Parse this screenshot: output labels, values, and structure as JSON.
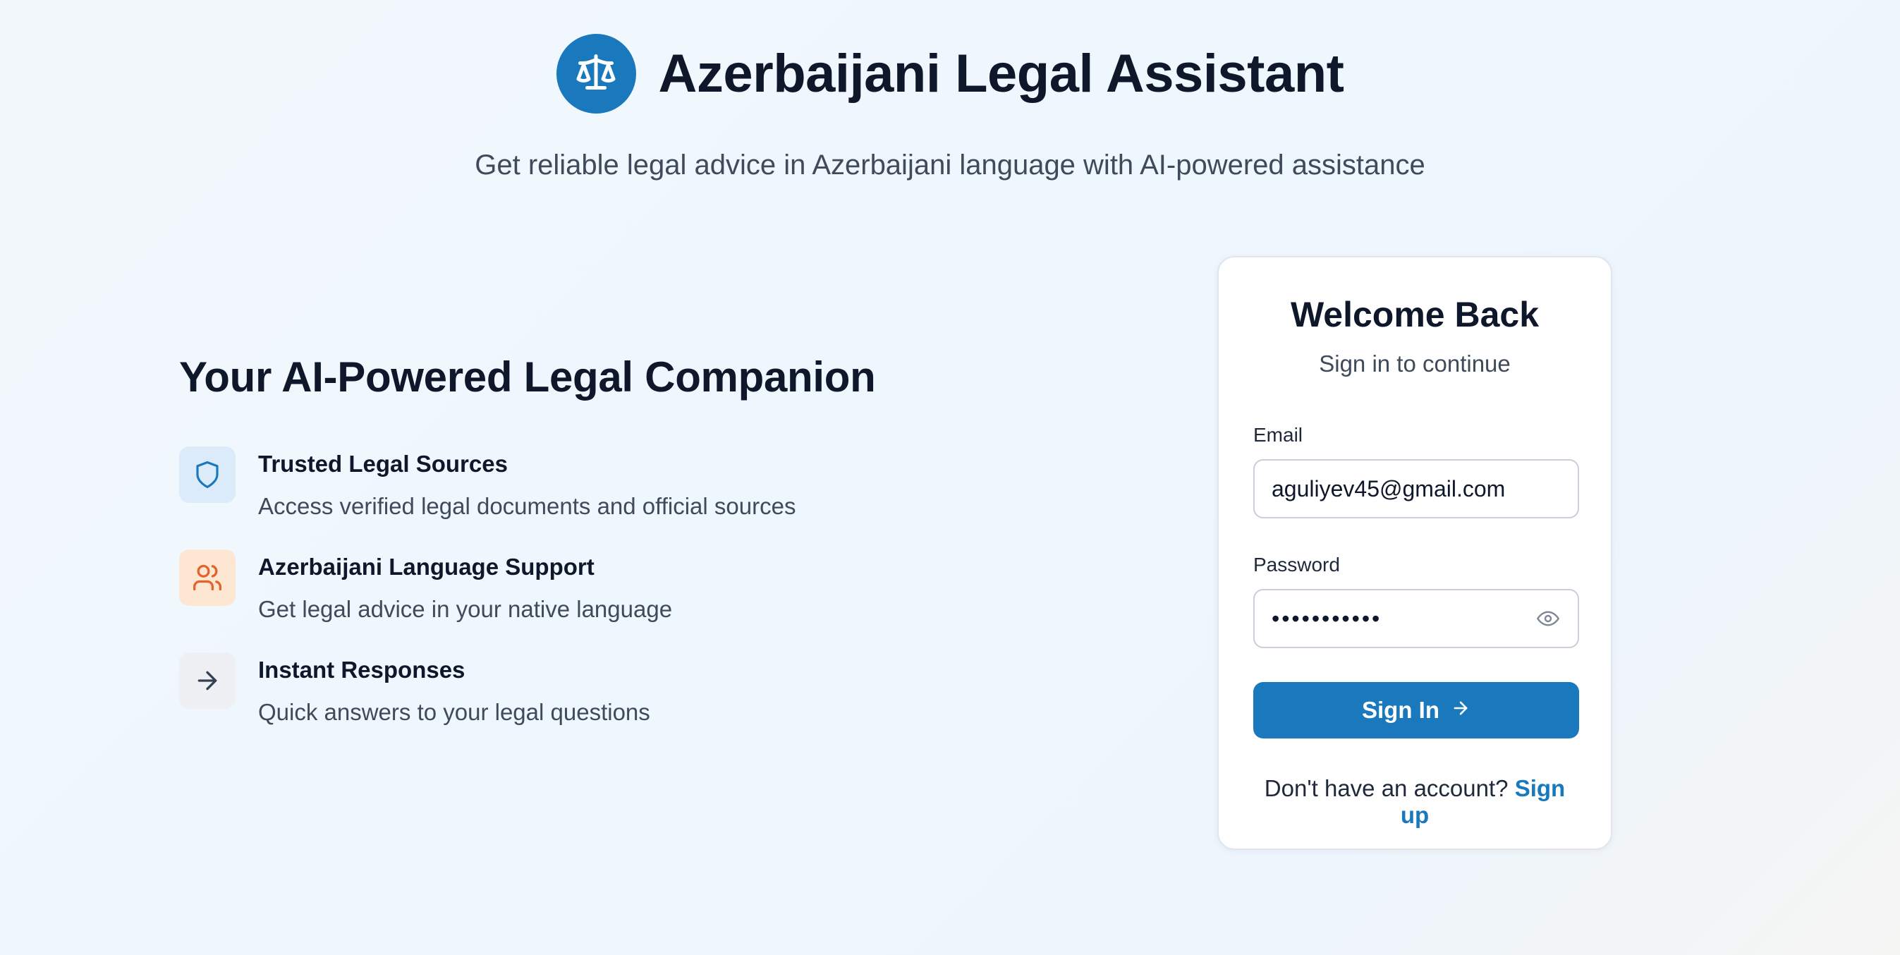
{
  "header": {
    "title": "Azerbaijani Legal Assistant",
    "subtitle": "Get reliable legal advice in Azerbaijani language with AI-powered assistance",
    "logo_icon": "scales-of-justice-icon"
  },
  "features": {
    "heading": "Your AI-Powered Legal Companion",
    "items": [
      {
        "title": "Trusted Legal Sources",
        "description": "Access verified legal documents and official sources",
        "icon": "shield-icon",
        "color": "#1a78bd"
      },
      {
        "title": "Azerbaijani Language Support",
        "description": "Get legal advice in your native language",
        "icon": "users-icon",
        "color": "#e5622a"
      },
      {
        "title": "Instant Responses",
        "description": "Quick answers to your legal questions",
        "icon": "arrow-right-icon",
        "color": "#334155"
      }
    ]
  },
  "login": {
    "title": "Welcome Back",
    "subtitle": "Sign in to continue",
    "email_label": "Email",
    "email_value": "aguliyev45@gmail.com",
    "password_label": "Password",
    "password_value": "•••••••••••",
    "submit_label": "Sign In",
    "signup_prompt": "Don't have an account?",
    "signup_link": "Sign up"
  },
  "colors": {
    "accent": "#1a78bd",
    "orange": "#e5622a"
  }
}
